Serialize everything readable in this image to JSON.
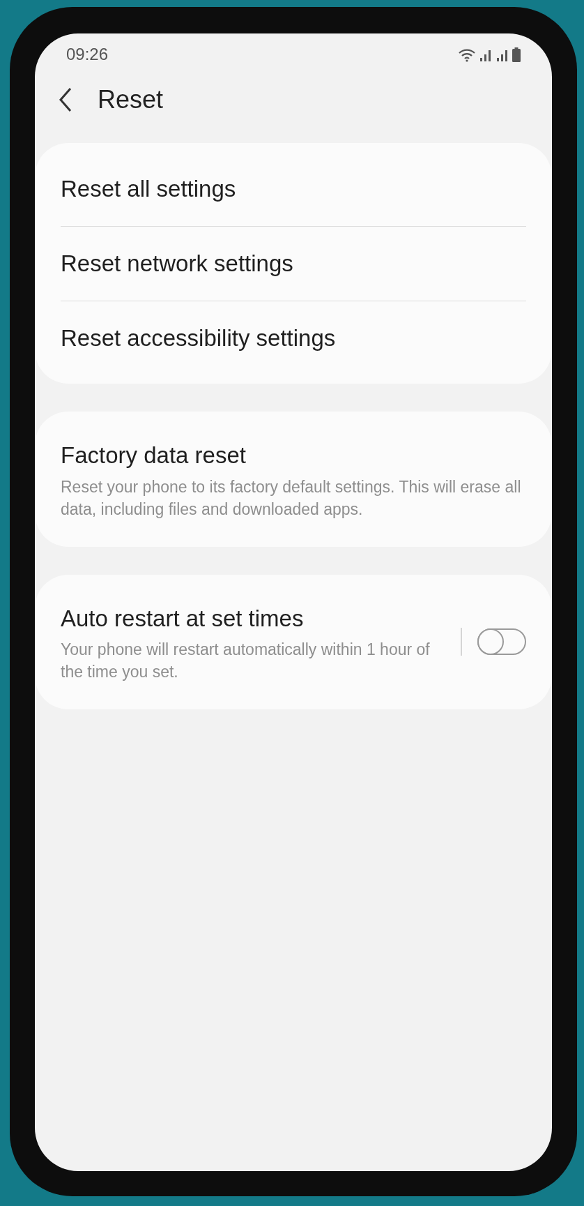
{
  "status_bar": {
    "time": "09:26"
  },
  "header": {
    "title": "Reset"
  },
  "groups": [
    {
      "items": [
        {
          "title": "Reset all settings"
        },
        {
          "title": "Reset network settings"
        },
        {
          "title": "Reset accessibility settings"
        }
      ]
    },
    {
      "items": [
        {
          "title": "Factory data reset",
          "description": "Reset your phone to its factory default settings. This will erase all data, including files and downloaded apps."
        }
      ]
    },
    {
      "items": [
        {
          "title": "Auto restart at set times",
          "description": "Your phone will restart automatically within 1 hour of the time you set.",
          "kind": "switch",
          "on": false
        }
      ]
    }
  ]
}
